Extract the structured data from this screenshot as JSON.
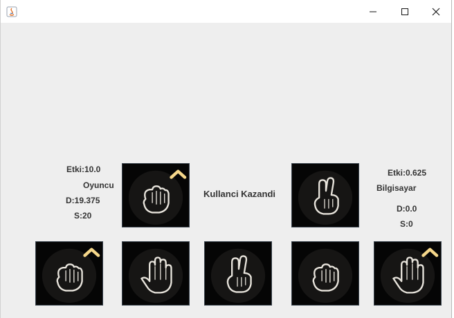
{
  "window": {
    "title": ""
  },
  "player": {
    "etki": "Etki:10.0",
    "name": "Oyuncu",
    "d": "D:19.375",
    "s": "S:20",
    "selected": "rock"
  },
  "result": "Kullanci Kazandi",
  "computer": {
    "etki": "Etki:0.625",
    "name": "Bilgisayar",
    "d": "D:0.0",
    "s": "S:0",
    "selected": "scissors"
  },
  "choices": [
    {
      "icon": "rock-hand-icon",
      "marked": true
    },
    {
      "icon": "paper-hand-icon",
      "marked": false
    },
    {
      "icon": "scissors-hand-icon",
      "marked": false
    },
    {
      "icon": "rock-hand-icon",
      "marked": false
    },
    {
      "icon": "paper-hand-icon",
      "marked": true
    }
  ],
  "colors": {
    "card_bg": "#050505",
    "marker": "#f5d78a",
    "background": "#eeeeee"
  }
}
